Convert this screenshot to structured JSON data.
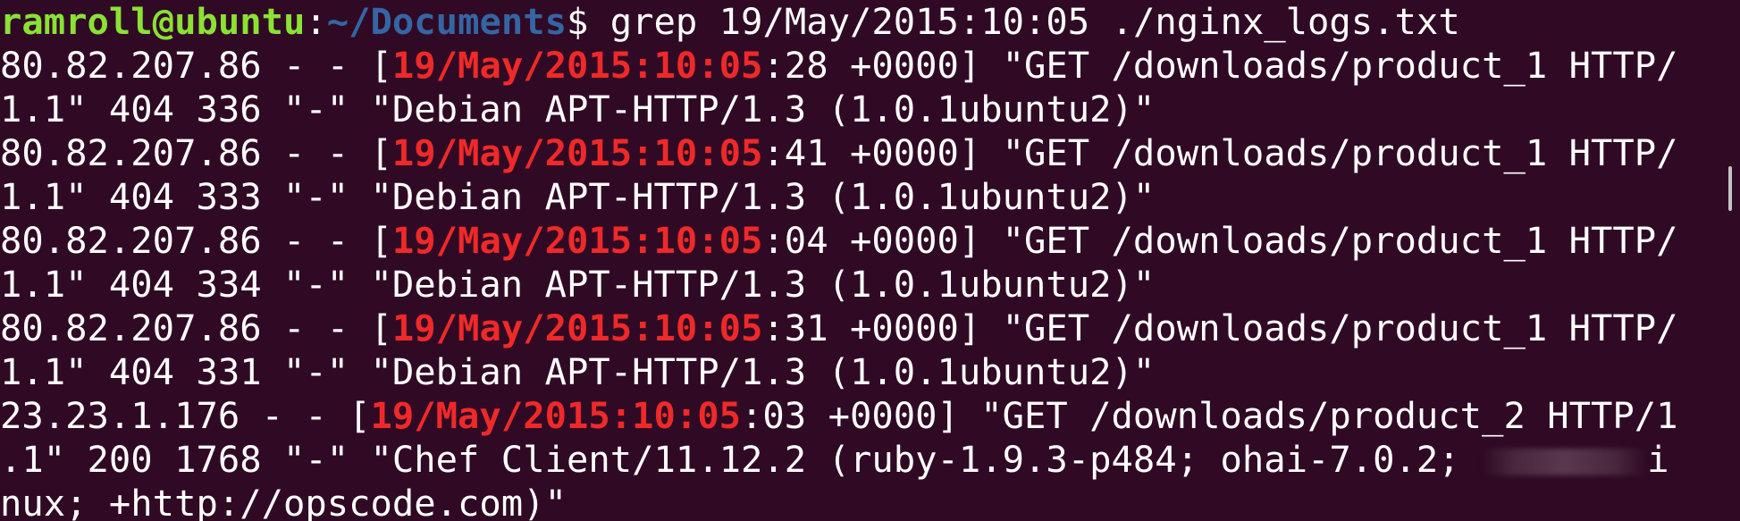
{
  "prompt": {
    "user_host": "ramroll@ubuntu",
    "colon": ":",
    "path": "~/Documents",
    "symbol": "$",
    "command": " grep 19/May/2015:10:05 ./nginx_logs.txt"
  },
  "match_text": "19/May/2015:10:05",
  "lines": [
    {
      "pre": "80.82.207.86 - - [",
      "post": ":28 +0000] \"GET /downloads/product_1 HTTP/"
    },
    {
      "text": "1.1\" 404 336 \"-\" \"Debian APT-HTTP/1.3 (1.0.1ubuntu2)\""
    },
    {
      "pre": "80.82.207.86 - - [",
      "post": ":41 +0000] \"GET /downloads/product_1 HTTP/"
    },
    {
      "text": "1.1\" 404 333 \"-\" \"Debian APT-HTTP/1.3 (1.0.1ubuntu2)\""
    },
    {
      "pre": "80.82.207.86 - - [",
      "post": ":04 +0000] \"GET /downloads/product_1 HTTP/"
    },
    {
      "text": "1.1\" 404 334 \"-\" \"Debian APT-HTTP/1.3 (1.0.1ubuntu2)\""
    },
    {
      "pre": "80.82.207.86 - - [",
      "post": ":31 +0000] \"GET /downloads/product_1 HTTP/"
    },
    {
      "text": "1.1\" 404 331 \"-\" \"Debian APT-HTTP/1.3 (1.0.1ubuntu2)\""
    },
    {
      "pre": "23.23.1.176 - - [",
      "post": ":03 +0000] \"GET /downloads/product_2 HTTP/1"
    },
    {
      "text": ".1\" 200 1768 \"-\" \"Chef Client/11.12.2 (ruby-1.9.3-p484; ohai-7.0.2; ",
      "tail": "i"
    },
    {
      "text": "nux; +http://opscode.com)\""
    }
  ],
  "colors": {
    "background": "#300a24",
    "foreground": "#ffffff",
    "user_host": "#8ae234",
    "path": "#3465a4",
    "match": "#ef2929"
  }
}
